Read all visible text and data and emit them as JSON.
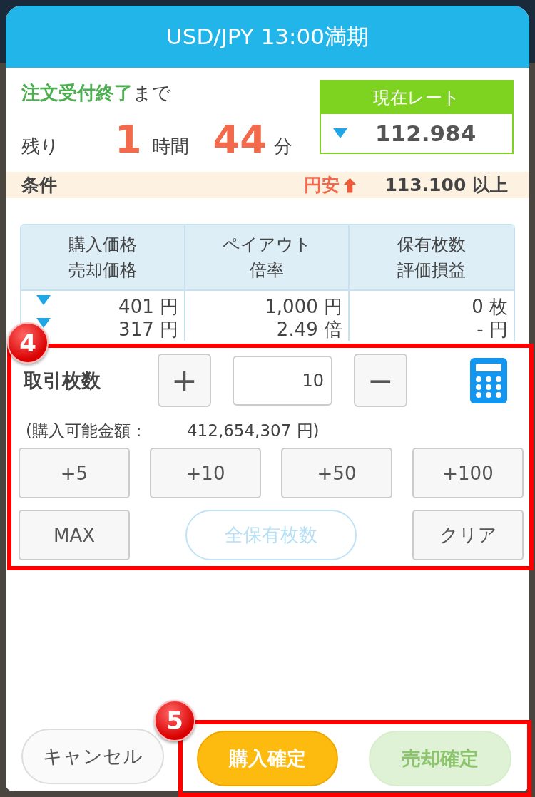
{
  "title": "USD/JPY 13:00満期",
  "deadline": {
    "highlight": "注文受付終了",
    "rest": "まで"
  },
  "remaining": {
    "label": "残り",
    "hours": "1",
    "hours_unit": "時間",
    "minutes": "44",
    "minutes_unit": "分"
  },
  "rate": {
    "label": "現在レート",
    "value": "112.984",
    "falling": true
  },
  "condition": {
    "label": "条件",
    "direction_text": "円安",
    "rising": true,
    "threshold": "113.100 以上"
  },
  "table": {
    "columns": [
      {
        "lines": [
          "購入価格",
          "売却価格"
        ]
      },
      {
        "lines": [
          "ペイアウト",
          "倍率"
        ]
      },
      {
        "lines": [
          "保有枚数",
          "評価損益"
        ]
      }
    ],
    "cells": [
      {
        "lines": [
          {
            "text": "401 円",
            "falling": true
          },
          {
            "text": "317 円",
            "falling": true
          }
        ]
      },
      {
        "lines": [
          {
            "text": "1,000 円",
            "falling": false
          },
          {
            "text": "2.49 倍",
            "falling": false
          }
        ]
      },
      {
        "lines": [
          {
            "text": "0 枚",
            "falling": false
          },
          {
            "text": "- 円",
            "falling": false
          }
        ]
      }
    ]
  },
  "quantity": {
    "annotation": "4",
    "label": "取引枚数",
    "plus": "+",
    "value": "10",
    "minus": "−",
    "available_label": "(購入可能金額：",
    "available_amount": "412,654,307 円)",
    "quick_buttons": [
      {
        "label": "+5",
        "kind": "square",
        "disabled": false
      },
      {
        "label": "+10",
        "kind": "square",
        "disabled": false
      },
      {
        "label": "+50",
        "kind": "square",
        "disabled": false
      },
      {
        "label": "+100",
        "kind": "square",
        "disabled": false
      },
      {
        "label": "MAX",
        "kind": "square",
        "disabled": false
      },
      {
        "label": "全保有枚数",
        "kind": "pill",
        "disabled": true
      },
      {
        "label": "クリア",
        "kind": "square",
        "disabled": false
      }
    ]
  },
  "footer": {
    "cancel": "キャンセル",
    "annotation": "5",
    "confirm_buttons": [
      {
        "label": "購入確定",
        "kind": "buy",
        "disabled": false
      },
      {
        "label": "売却確定",
        "kind": "sell",
        "disabled": true
      }
    ]
  }
}
